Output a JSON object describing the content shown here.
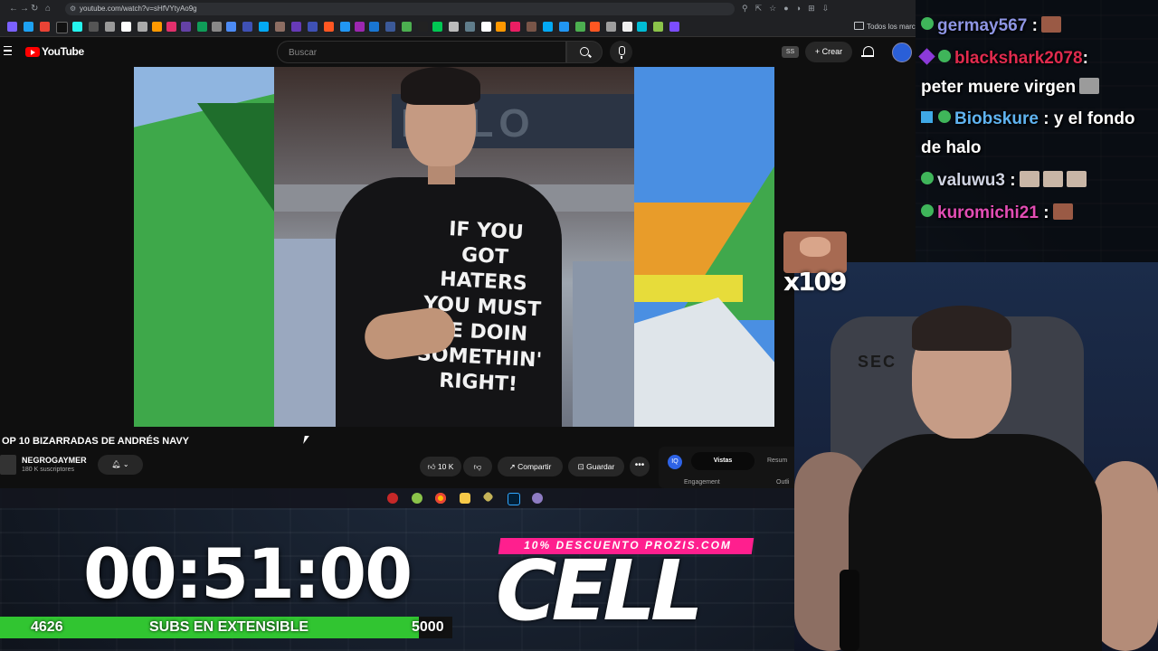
{
  "browser": {
    "url": "youtube.com/watch?v=sHfVYtyAo9g",
    "bookmarks_folder": "Todos los marcadores"
  },
  "youtube": {
    "logo_text": "YouTube",
    "search_placeholder": "Buscar",
    "ss_badge": "SS",
    "create_label": "+ Crear"
  },
  "video": {
    "shirt_text": "IF YOU\nGOT\nHATERS\nYOU MUST\nBE DOIN\nSOMETHIN'\nRIGHT!",
    "sign_text": "HALO",
    "title": "OP 10 BIZARRADAS DE ANDRÉS NAVY",
    "channel_name": "NEGROGAYMER",
    "channel_subs": "180 K suscriptores",
    "like_label": "10 K",
    "share_label": "Compartir",
    "save_label": "Guardar",
    "more_label": "•••",
    "panel": {
      "icon_text": "IQ",
      "tab_active": "Vistas",
      "tab_other": "Resum",
      "sub_label": "Engagement",
      "sub_label2": "Outli"
    }
  },
  "chat": {
    "messages": [
      {
        "user": "germay567",
        "text": ""
      },
      {
        "user": "blackshark2078",
        "text": "peter muere virgen"
      },
      {
        "user": "Biobskure",
        "text": "y el fondo",
        "text2": "de halo"
      },
      {
        "user": "valuwu3",
        "text": ""
      },
      {
        "user": "kuromichi21",
        "text": ""
      }
    ],
    "separator": ":"
  },
  "emote_overlay": {
    "count": "x109"
  },
  "webcam": {
    "chair_brand": "SEC"
  },
  "subathon": {
    "timer": "00:51:00",
    "current": "4626",
    "label": "SUBS EN EXTENSIBLE",
    "goal": "5000",
    "progress": 0.925
  },
  "promo": {
    "strip": "10% DESCUENTO PROZIS.COM",
    "code": "CELL",
    "strip_color": "#ff1f8e",
    "bar_color": "#31c531"
  }
}
